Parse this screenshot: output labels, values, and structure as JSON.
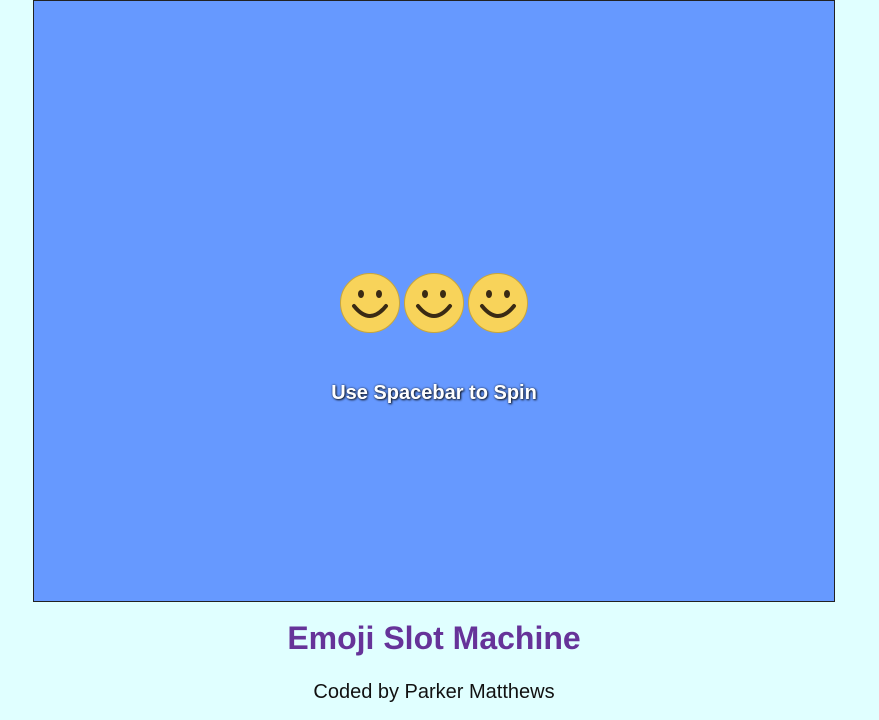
{
  "game": {
    "reels": [
      {
        "icon": "smiley-face-icon",
        "glyph": "🙂"
      },
      {
        "icon": "smiley-face-icon",
        "glyph": "🙂"
      },
      {
        "icon": "smiley-face-icon",
        "glyph": "🙂"
      }
    ],
    "instruction": "Use Spacebar to Spin",
    "canvas_color": "#6699ff"
  },
  "footer": {
    "title": "Emoji Slot Machine",
    "credit": "Coded by Parker Matthews",
    "title_color": "#663399"
  },
  "page": {
    "background": "#e0ffff"
  }
}
